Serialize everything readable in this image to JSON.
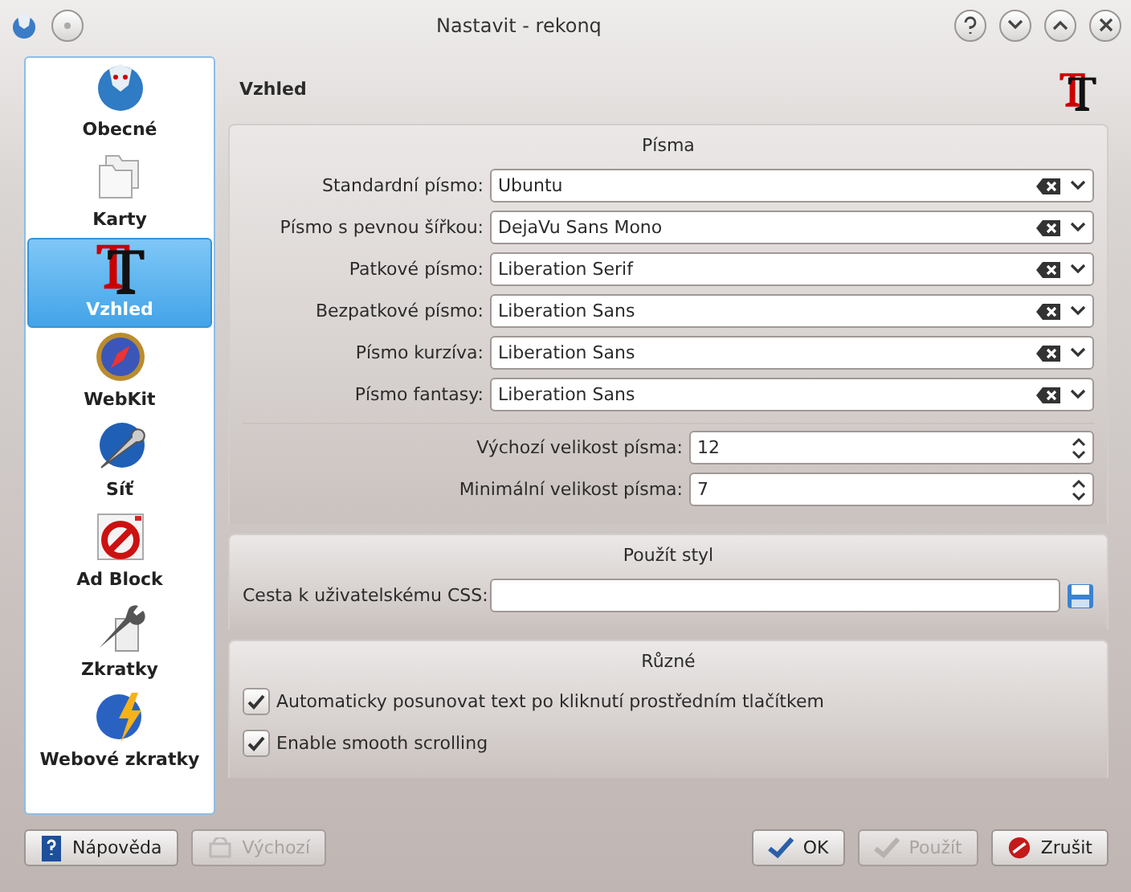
{
  "window": {
    "title": "Nastavit - rekonq"
  },
  "sidebar": {
    "items": [
      {
        "label": "Obecné",
        "selected": false
      },
      {
        "label": "Karty",
        "selected": false
      },
      {
        "label": "Vzhled",
        "selected": true
      },
      {
        "label": "WebKit",
        "selected": false
      },
      {
        "label": "Síť",
        "selected": false
      },
      {
        "label": "Ad Block",
        "selected": false
      },
      {
        "label": "Zkratky",
        "selected": false
      },
      {
        "label": "Webové zkratky",
        "selected": false
      }
    ]
  },
  "page": {
    "title": "Vzhled"
  },
  "fonts": {
    "title": "Písma",
    "font_rows": [
      {
        "label": "Standardní písmo:",
        "value": "Ubuntu"
      },
      {
        "label": "Písmo s pevnou šířkou:",
        "value": "DejaVu Sans Mono"
      },
      {
        "label": "Patkové písmo:",
        "value": "Liberation Serif"
      },
      {
        "label": "Bezpatkové písmo:",
        "value": "Liberation Sans"
      },
      {
        "label": "Písmo kurzíva:",
        "value": "Liberation Sans"
      },
      {
        "label": "Písmo fantasy:",
        "value": "Liberation Sans"
      }
    ],
    "size_rows": [
      {
        "label": "Výchozí velikost písma:",
        "value": "12"
      },
      {
        "label": "Minimální velikost písma:",
        "value": "7"
      }
    ]
  },
  "style": {
    "title": "Použít styl",
    "css_label": "Cesta k uživatelskému CSS:"
  },
  "misc": {
    "title": "Různé",
    "options": [
      {
        "label": "Automaticky posunovat text po kliknutí prostředním tlačítkem",
        "checked": true
      },
      {
        "label": "Enable smooth scrolling",
        "checked": true
      }
    ]
  },
  "buttons_left": [
    {
      "label": "Nápověda",
      "kind": "help",
      "disabled": false
    },
    {
      "label": "Výchozí",
      "kind": "defaults",
      "disabled": true
    }
  ],
  "buttons_right": [
    {
      "label": "OK",
      "kind": "ok",
      "disabled": false
    },
    {
      "label": "Použít",
      "kind": "apply",
      "disabled": true
    },
    {
      "label": "Zrušit",
      "kind": "cancel",
      "disabled": false
    }
  ]
}
